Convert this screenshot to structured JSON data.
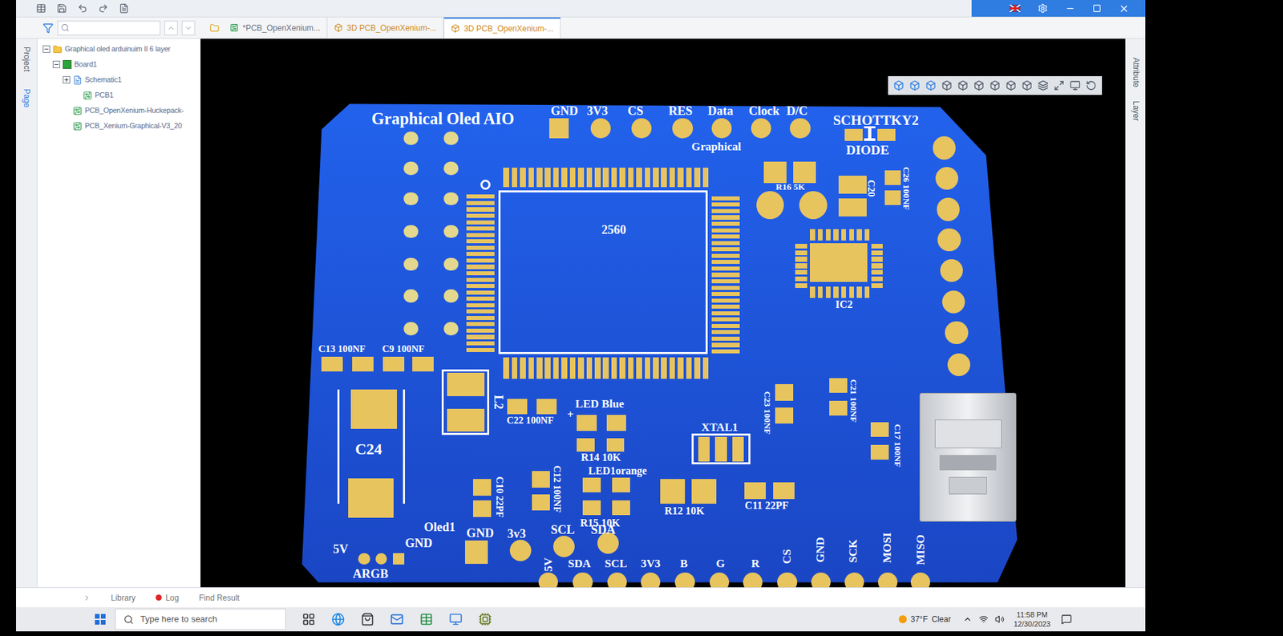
{
  "tabs": [
    {
      "label": "*PCB_OpenXenium...",
      "selected": false,
      "kind": "pcb"
    },
    {
      "label": "3D PCB_OpenXenium-...",
      "selected": false,
      "kind": "3d"
    },
    {
      "label": "3D PCB_OpenXenium-...",
      "selected": true,
      "kind": "3d"
    }
  ],
  "side_tabs_left": [
    {
      "label": "Project",
      "selected": false
    },
    {
      "label": "Page",
      "selected": true
    }
  ],
  "side_tabs_right": [
    {
      "label": "Attribute"
    },
    {
      "label": "Layer"
    }
  ],
  "project_tree": [
    {
      "label": "Graphical oled arduinuim II 6 layer",
      "level": 0,
      "kind": "folder",
      "expandable": true,
      "expanded": true
    },
    {
      "label": "Board1",
      "level": 1,
      "kind": "board",
      "expandable": true,
      "expanded": true
    },
    {
      "label": "Schematic1",
      "level": 2,
      "kind": "schematic",
      "expandable": true,
      "expanded": false
    },
    {
      "label": "PCB1",
      "level": 3,
      "kind": "pcb",
      "expandable": false,
      "expanded": false
    },
    {
      "label": "PCB_OpenXenium-Huckepack-",
      "level": 2,
      "kind": "pcb",
      "expandable": false,
      "expanded": false
    },
    {
      "label": "PCB_Xenium-Graphical-V3_20",
      "level": 2,
      "kind": "pcb",
      "expandable": false,
      "expanded": false
    }
  ],
  "bottom_tabs": [
    {
      "label": "Library",
      "alert": false
    },
    {
      "label": "Log",
      "alert": true
    },
    {
      "label": "Find Result",
      "alert": false
    }
  ],
  "taskbar": {
    "search_placeholder": "Type here to search",
    "temperature": "37°F",
    "weather": "Clear",
    "time": "11:58 PM",
    "date": "12/30/2023"
  },
  "board": {
    "silkscreen": [
      "Graphical Oled AIO",
      "GND",
      "3V3",
      "CS",
      "RES",
      "Data",
      "Clock",
      "D/C",
      "Graphical",
      "SCHOTTKY2",
      "DIODE",
      "R16 5K",
      "C20",
      "C26 100NF",
      "2560",
      "IC2",
      "C13 100NF",
      "C9 100NF",
      "L2",
      "C22 100NF",
      "+",
      "LED Blue",
      "R14 10K",
      "LED1orange",
      "XTAL1",
      "C23 100NF",
      "C21 100NF",
      "C17 100NF",
      "C24",
      "C10 22PF",
      "C12 100NF",
      "R15 10K",
      "R12 10K",
      "C11 22PF",
      "Oled1",
      "GND",
      "3v3",
      "SCL",
      "SDA",
      "5V",
      "GND",
      "ARGB",
      "5V",
      "SDA",
      "SCL",
      "3V3",
      "B",
      "G",
      "R",
      "CS",
      "GND",
      "SCK",
      "MOSI",
      "MISO"
    ]
  }
}
